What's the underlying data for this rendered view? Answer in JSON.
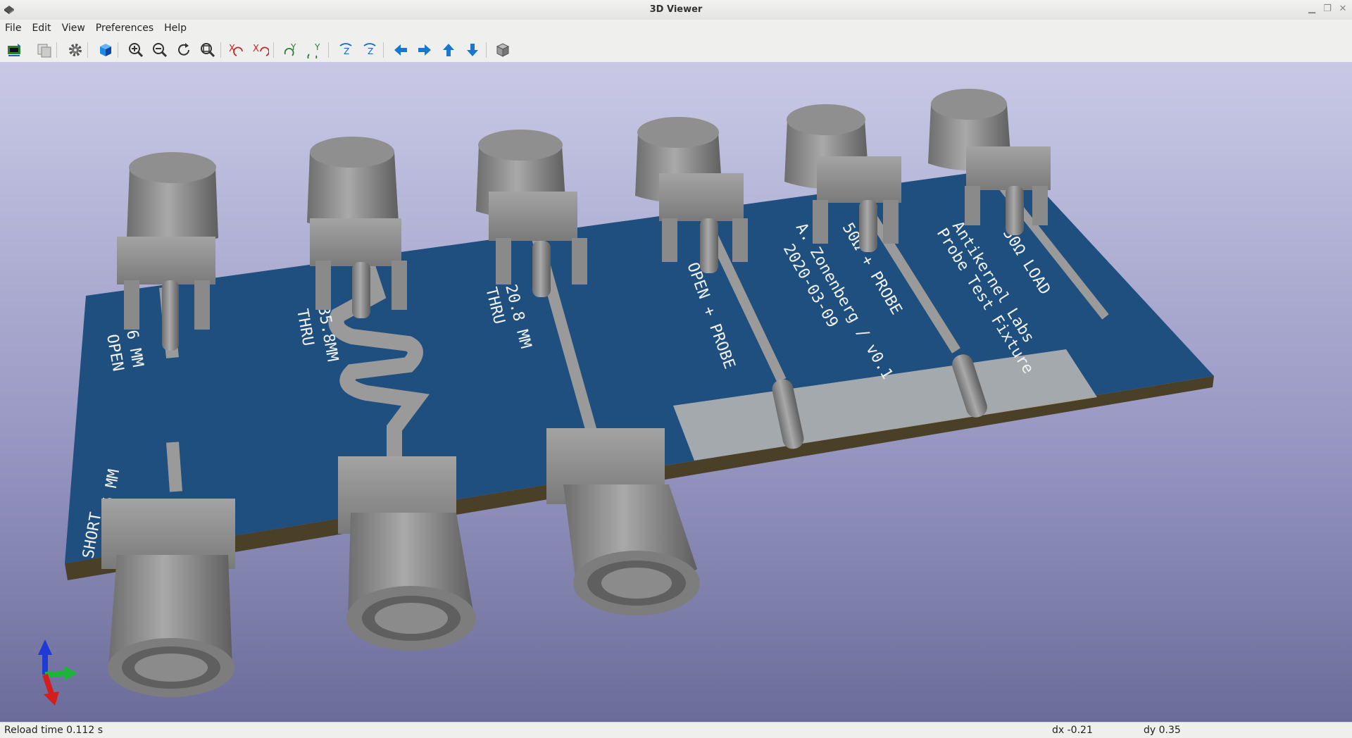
{
  "window": {
    "title": "3D Viewer"
  },
  "menu": [
    "File",
    "Edit",
    "View",
    "Preferences",
    "Help"
  ],
  "toolbar": [
    {
      "name": "reload-board-icon"
    },
    {
      "name": "copy-image-icon"
    },
    {
      "name": "settings-gear-icon"
    },
    {
      "name": "raytrace-cube-icon"
    },
    {
      "name": "zoom-in-icon"
    },
    {
      "name": "zoom-out-icon"
    },
    {
      "name": "redraw-icon"
    },
    {
      "name": "zoom-fit-icon"
    },
    {
      "name": "rotate-x-ccw-icon"
    },
    {
      "name": "rotate-x-cw-icon"
    },
    {
      "name": "rotate-y-ccw-icon"
    },
    {
      "name": "rotate-y-cw-icon"
    },
    {
      "name": "rotate-z-ccw-icon"
    },
    {
      "name": "rotate-z-cw-icon"
    },
    {
      "name": "move-left-icon"
    },
    {
      "name": "move-right-icon"
    },
    {
      "name": "move-up-icon"
    },
    {
      "name": "move-down-icon"
    },
    {
      "name": "ortho-view-icon"
    }
  ],
  "pcb_labels": {
    "open6": [
      "6 MM",
      "OPEN"
    ],
    "short6": [
      "6 MM",
      "SHORT"
    ],
    "thru358": [
      "35.8MM",
      "THRU"
    ],
    "thru208": [
      "20.8 MM",
      "THRU"
    ],
    "open_probe": "OPEN + PROBE",
    "author": [
      "A. Zonenberg / v0.1",
      "2020-03-09"
    ],
    "probe50": "50Ω + PROBE",
    "company": [
      "Antikernel Labs",
      "Probe Test Fixture"
    ],
    "load50": "50Ω LOAD"
  },
  "colors": {
    "board": "#1e4f7e",
    "connector": "#8c8c8c",
    "copper": "#bdbdbd"
  },
  "status": {
    "reload": "Reload time 0.112 s",
    "dx": "dx -0.21",
    "dy": "dy 0.35"
  }
}
